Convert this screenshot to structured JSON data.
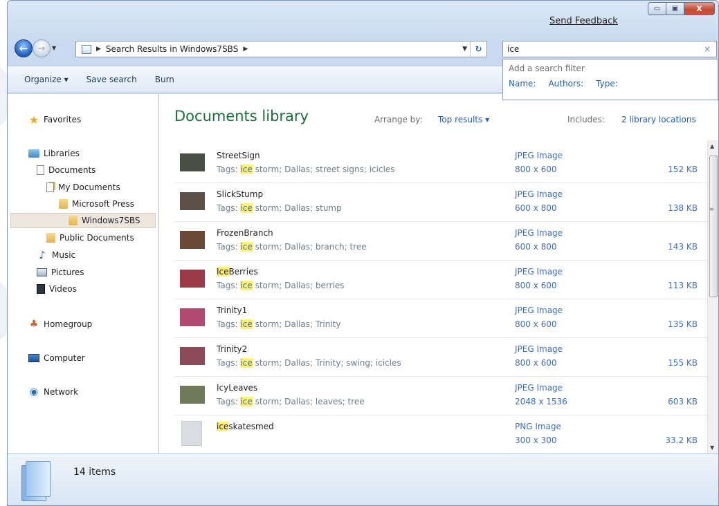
{
  "window": {
    "feedback_label": "Send Feedback",
    "minimize_glyph": "▭",
    "maximize_glyph": "▣",
    "close_glyph": "x"
  },
  "address": {
    "crumb_sep": "▶",
    "location": "Search Results in Windows7SBS",
    "crumb_sep2": "▶",
    "dropdown_glyph": "▼",
    "refresh_glyph": "↻"
  },
  "search": {
    "query": "ice",
    "clear_glyph": "×",
    "popup_title": "Add a search filter",
    "filters": [
      "Name:",
      "Authors:",
      "Type:"
    ]
  },
  "toolbar": {
    "organize": "Organize ▾",
    "save_search": "Save search",
    "burn": "Burn"
  },
  "nav": {
    "favorites": "Favorites",
    "libraries": "Libraries",
    "documents": "Documents",
    "my_documents": "My Documents",
    "microsoft_press": "Microsoft Press",
    "windows7sbs": "Windows7SBS",
    "public_documents": "Public Documents",
    "music": "Music",
    "pictures": "Pictures",
    "videos": "Videos",
    "homegroup": "Homegroup",
    "computer": "Computer",
    "network": "Network"
  },
  "content": {
    "title": "Documents library",
    "arrange_label": "Arrange by:",
    "arrange_value": "Top results ▾",
    "includes_label": "Includes:",
    "includes_value": "2 library locations"
  },
  "files": [
    {
      "name_hl": "",
      "name_rest": "StreetSign",
      "tags_prefix": "Tags: ",
      "tags_hl": "ice",
      "tags_rest": " storm; Dallas; street signs; icicles",
      "type": "JPEG Image",
      "dims": "800 x 600",
      "size": "152 KB",
      "thumb_color": "#4a4f45"
    },
    {
      "name_hl": "",
      "name_rest": "SlickStump",
      "tags_prefix": "Tags: ",
      "tags_hl": "ice",
      "tags_rest": " storm; Dallas; stump",
      "type": "JPEG Image",
      "dims": "600 x 800",
      "size": "138 KB",
      "thumb_color": "#5c5048"
    },
    {
      "name_hl": "",
      "name_rest": "FrozenBranch",
      "tags_prefix": "Tags: ",
      "tags_hl": "ice",
      "tags_rest": " storm; Dallas; branch; tree",
      "type": "JPEG Image",
      "dims": "600 x 800",
      "size": "143 KB",
      "thumb_color": "#6a4a36"
    },
    {
      "name_hl": "Ice",
      "name_rest": "Berries",
      "tags_prefix": "Tags: ",
      "tags_hl": "ice",
      "tags_rest": " storm; Dallas; berries",
      "type": "JPEG Image",
      "dims": "800 x 600",
      "size": "113 KB",
      "thumb_color": "#9c3a4a"
    },
    {
      "name_hl": "",
      "name_rest": "Trinity1",
      "tags_prefix": "Tags: ",
      "tags_hl": "ice",
      "tags_rest": " storm; Dallas; Trinity",
      "type": "JPEG Image",
      "dims": "800 x 600",
      "size": "135 KB",
      "thumb_color": "#b0486f"
    },
    {
      "name_hl": "",
      "name_rest": "Trinity2",
      "tags_prefix": "Tags: ",
      "tags_hl": "ice",
      "tags_rest": " storm; Dallas; Trinity; swing; icicles",
      "type": "JPEG Image",
      "dims": "800 x 600",
      "size": "155 KB",
      "thumb_color": "#8a4a58"
    },
    {
      "name_hl": "",
      "name_rest": "IcyLeaves",
      "tags_prefix": "Tags: ",
      "tags_hl": "ice",
      "tags_rest": " storm; Dallas; leaves; tree",
      "type": "JPEG Image",
      "dims": "2048 x 1536",
      "size": "603 KB",
      "thumb_color": "#6f7a5a"
    },
    {
      "name_hl": "ice",
      "name_rest": "skatesmed",
      "tags_prefix": "",
      "tags_hl": "",
      "tags_rest": "",
      "type": "PNG Image",
      "dims": "300 x 300",
      "size": "33.2 KB",
      "thumb_color": "#d9dde2"
    }
  ],
  "status": {
    "count": "14 items"
  }
}
